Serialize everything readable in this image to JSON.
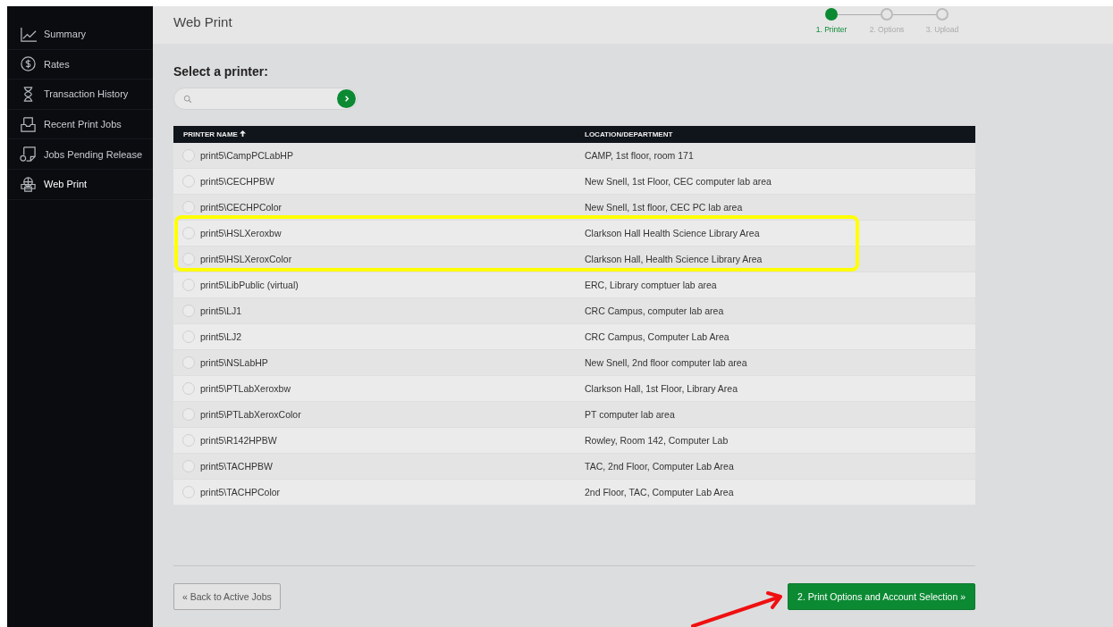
{
  "sidebar": {
    "items": [
      {
        "label": "Summary",
        "selected": false
      },
      {
        "label": "Rates",
        "selected": false
      },
      {
        "label": "Transaction History",
        "selected": false
      },
      {
        "label": "Recent Print Jobs",
        "selected": false
      },
      {
        "label": "Jobs Pending Release",
        "selected": false
      },
      {
        "label": "Web Print",
        "selected": true
      }
    ]
  },
  "header": {
    "title": "Web Print",
    "steps": [
      {
        "label": "1. Printer",
        "selected": true
      },
      {
        "label": "2. Options",
        "selected": false
      },
      {
        "label": "3. Upload",
        "selected": false
      }
    ]
  },
  "heading": "Select a printer:",
  "table": {
    "columns": [
      {
        "label": "PRINTER NAME",
        "sorted": true
      },
      {
        "label": "LOCATION/DEPARTMENT",
        "sorted": false
      }
    ],
    "rows": [
      {
        "name": "print5\\CampPCLabHP",
        "location": "CAMP, 1st floor, room 171",
        "selected": false,
        "highlighted": false
      },
      {
        "name": "print5\\CECHPBW",
        "location": "New Snell, 1st Floor, CEC computer lab area",
        "selected": false,
        "highlighted": false
      },
      {
        "name": "print5\\CECHPColor",
        "location": "New Snell, 1st floor, CEC PC lab area",
        "selected": false,
        "highlighted": false
      },
      {
        "name": "print5\\HSLXeroxbw",
        "location": "Clarkson Hall Health Science Library Area",
        "selected": false,
        "highlighted": true
      },
      {
        "name": "print5\\HSLXeroxColor",
        "location": "Clarkson Hall, Health Science Library Area",
        "selected": false,
        "highlighted": true
      },
      {
        "name": "print5\\LibPublic (virtual)",
        "location": "ERC, Library comptuer lab area",
        "selected": false,
        "highlighted": false
      },
      {
        "name": "print5\\LJ1",
        "location": "CRC Campus, computer lab area",
        "selected": false,
        "highlighted": false
      },
      {
        "name": "print5\\LJ2",
        "location": "CRC Campus, Computer Lab Area",
        "selected": false,
        "highlighted": false
      },
      {
        "name": "print5\\NSLabHP",
        "location": "New Snell, 2nd floor computer lab area",
        "selected": false,
        "highlighted": false
      },
      {
        "name": "print5\\PTLabXeroxbw",
        "location": "Clarkson Hall, 1st Floor, Library Area",
        "selected": false,
        "highlighted": false
      },
      {
        "name": "print5\\PTLabXeroxColor",
        "location": "PT computer lab area",
        "selected": false,
        "highlighted": false
      },
      {
        "name": "print5\\R142HPBW",
        "location": "Rowley, Room 142, Computer Lab",
        "selected": false,
        "highlighted": false
      },
      {
        "name": "print5\\TACHPBW",
        "location": "TAC, 2nd Floor, Computer Lab Area",
        "selected": false,
        "highlighted": false
      },
      {
        "name": "print5\\TACHPColor",
        "location": "2nd Floor, TAC, Computer Lab Area",
        "selected": false,
        "highlighted": false
      }
    ]
  },
  "buttons": {
    "back": "« Back to Active Jobs",
    "next": "2. Print Options and Account Selection »"
  }
}
